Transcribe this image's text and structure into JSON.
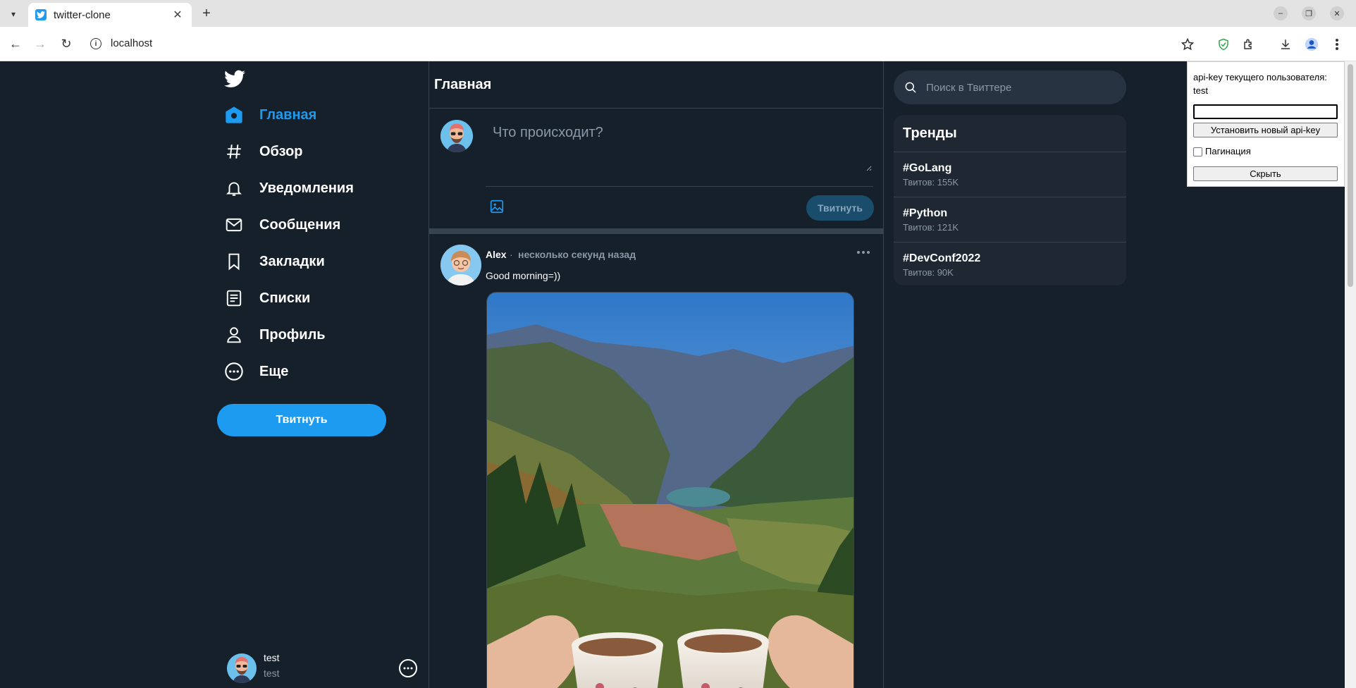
{
  "browser": {
    "tab_title": "twitter-clone",
    "url": "localhost"
  },
  "sidebar": {
    "items": [
      {
        "label": "Главная",
        "icon": "home-icon",
        "active": true
      },
      {
        "label": "Обзор",
        "icon": "hashtag-icon"
      },
      {
        "label": "Уведомления",
        "icon": "bell-icon"
      },
      {
        "label": "Сообщения",
        "icon": "mail-icon"
      },
      {
        "label": "Закладки",
        "icon": "bookmark-icon"
      },
      {
        "label": "Списки",
        "icon": "list-icon"
      },
      {
        "label": "Профиль",
        "icon": "profile-icon"
      },
      {
        "label": "Еще",
        "icon": "more-circle-icon"
      }
    ],
    "tweet_button": "Твитнуть",
    "account": {
      "name": "test",
      "handle": "test"
    }
  },
  "main": {
    "title": "Главная",
    "composer": {
      "placeholder": "Что происходит?",
      "submit_label": "Твитнуть"
    },
    "posts": [
      {
        "author": "Alex",
        "separator": "·",
        "time": "несколько секунд назад",
        "text": "Good morning=))"
      }
    ]
  },
  "right": {
    "search_placeholder": "Поиск в Твиттере",
    "trends_title": "Тренды",
    "trends": [
      {
        "tag": "#GoLang",
        "count": "Твитов: 155K"
      },
      {
        "tag": "#Python",
        "count": "Твитов: 121K"
      },
      {
        "tag": "#DevConf2022",
        "count": "Твитов: 90K"
      }
    ]
  },
  "apikey_panel": {
    "text": "api-key текущего пользователя: test",
    "input_value": "",
    "set_button": "Установить новый api-key",
    "pagination_label": "Пагинация",
    "pagination_checked": false,
    "hide_button": "Скрыть"
  },
  "colors": {
    "background": "#15202b",
    "accent": "#1d9bf0",
    "border": "#38444d",
    "muted_text": "#8b98a5"
  }
}
